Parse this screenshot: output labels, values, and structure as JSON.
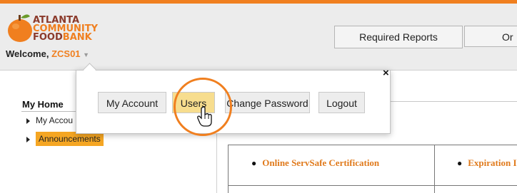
{
  "logo": {
    "line1": "ATLANTA",
    "line2": "COMMUNITY",
    "line3": "FOOD",
    "line3b": "BANK",
    "icon": "orange-fruit-logo"
  },
  "welcome": {
    "prefix": "Welcome,",
    "username": "ZCS01",
    "caret": "▼"
  },
  "nav": {
    "tab1": "Required Reports",
    "tab2": "Or"
  },
  "popup": {
    "close": "×",
    "buttons": [
      "My Account",
      "Users",
      "Change Password",
      "Logout"
    ]
  },
  "sidebar": {
    "title": "My Home",
    "items": [
      "My Accou",
      "Announcements"
    ]
  },
  "table": {
    "cell1": "Online ServSafe Certification",
    "cell2": "Expiration I"
  },
  "colors": {
    "accent": "#f07f1f",
    "highlight_button": "#f7dd8e",
    "announcements_bg": "#f5a623"
  }
}
